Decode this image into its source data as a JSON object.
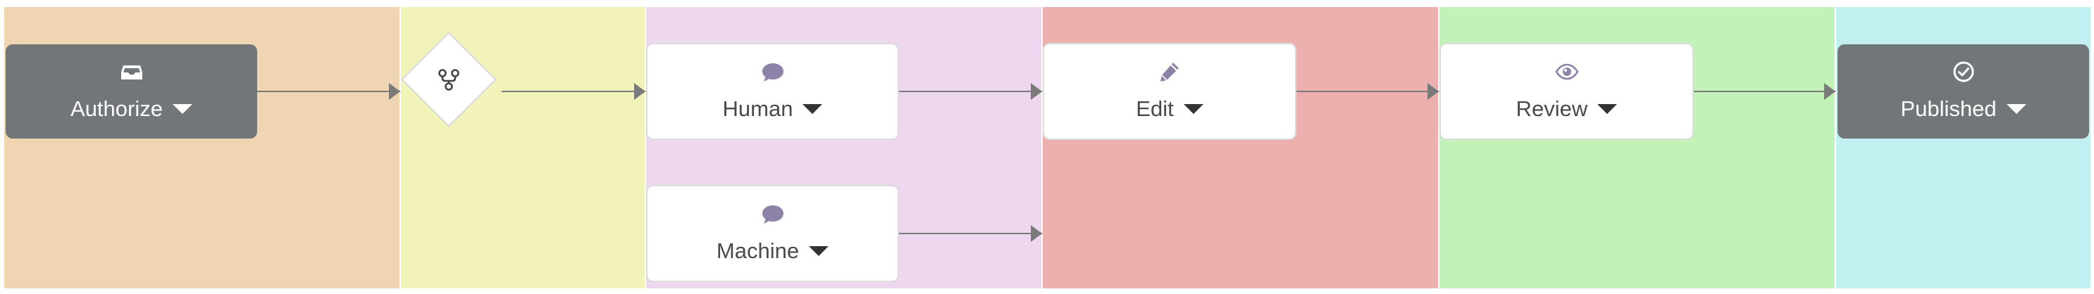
{
  "lanes": [
    {
      "id": "authorize",
      "color": "#f0d5b3"
    },
    {
      "id": "route",
      "color": "#f2f3b8"
    },
    {
      "id": "translate",
      "color": "#eed8f0"
    },
    {
      "id": "edit",
      "color": "#ecb0ae"
    },
    {
      "id": "review",
      "color": "#c3f2b9"
    },
    {
      "id": "published",
      "color": "#c2f0f1"
    }
  ],
  "nodes": {
    "authorize": {
      "label": "Authorize",
      "icon": "inbox-icon"
    },
    "route": {
      "icon": "fork-icon"
    },
    "human": {
      "label": "Human",
      "icon": "speech-bubble-icon"
    },
    "machine": {
      "label": "Machine",
      "icon": "speech-bubble-icon"
    },
    "edit": {
      "label": "Edit",
      "icon": "pencil-icon"
    },
    "review": {
      "label": "Review",
      "icon": "eye-icon"
    },
    "published": {
      "label": "Published",
      "icon": "check-circle-icon"
    }
  },
  "colors": {
    "dark_node": "#717679",
    "icon_purple": "#8e82a8",
    "edge": "#7a7a7a"
  }
}
